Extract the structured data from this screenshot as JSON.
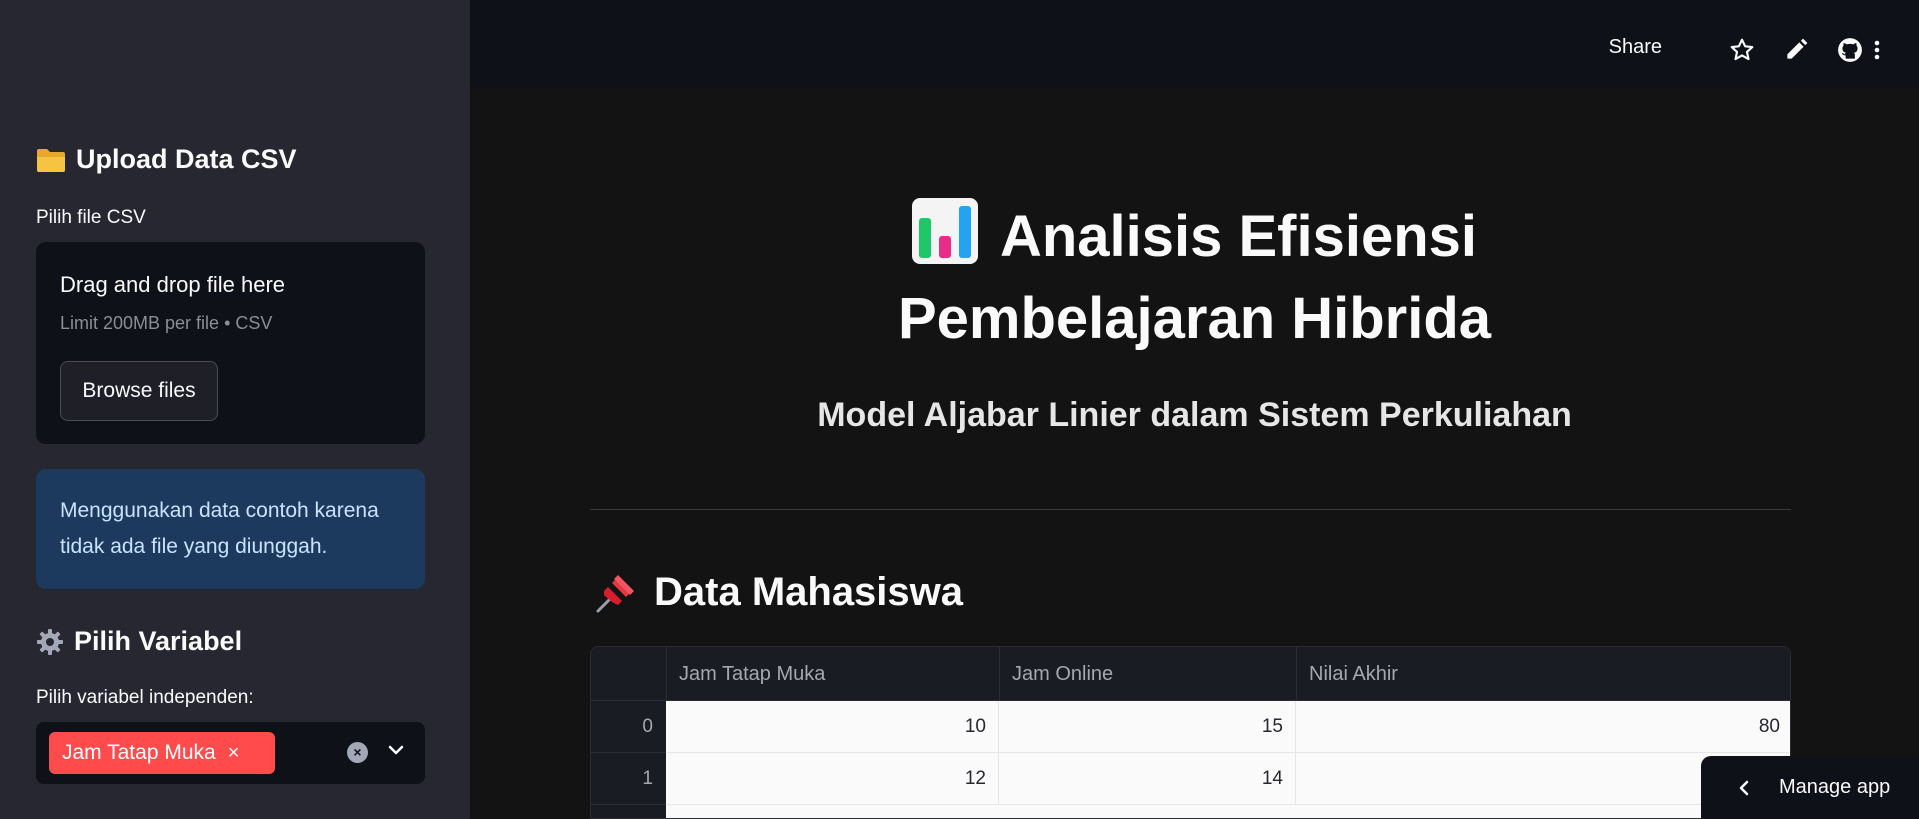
{
  "sidebar": {
    "upload_heading": "Upload Data CSV",
    "upload_icon": "folder-icon",
    "file_label": "Pilih file CSV",
    "dropzone": {
      "title": "Drag and drop file here",
      "subtitle": "Limit 200MB per file • CSV",
      "browse_label": "Browse files"
    },
    "info_text": "Menggunakan data contoh karena tidak ada file yang diunggah.",
    "variable_heading": "Pilih Variabel",
    "variable_icon": "gear-icon",
    "independent_label": "Pilih variabel independen:",
    "selected_tags": [
      "Jam Tatap Muka"
    ]
  },
  "topbar": {
    "share_label": "Share"
  },
  "main": {
    "title": "Analisis Efisiensi Pembelajaran Hibrida",
    "title_icon": "bar-chart-icon",
    "subtitle": "Model Aljabar Linier dalam Sistem Perkuliahan",
    "section_heading": "Data Mahasiswa",
    "section_icon": "pushpin-icon",
    "table": {
      "columns": [
        "Jam Tatap Muka",
        "Jam Online",
        "Nilai Akhir"
      ],
      "rows": [
        {
          "index": "0",
          "cells": [
            "10",
            "15",
            "80"
          ]
        },
        {
          "index": "1",
          "cells": [
            "12",
            "14",
            ""
          ]
        }
      ]
    }
  },
  "manage_app_label": "Manage app",
  "colors": {
    "sidebar_bg": "#262730",
    "app_bg": "#0e1117",
    "main_bg": "#131313",
    "accent": "#ff4b4b",
    "info_bg": "#1c3a5e"
  }
}
